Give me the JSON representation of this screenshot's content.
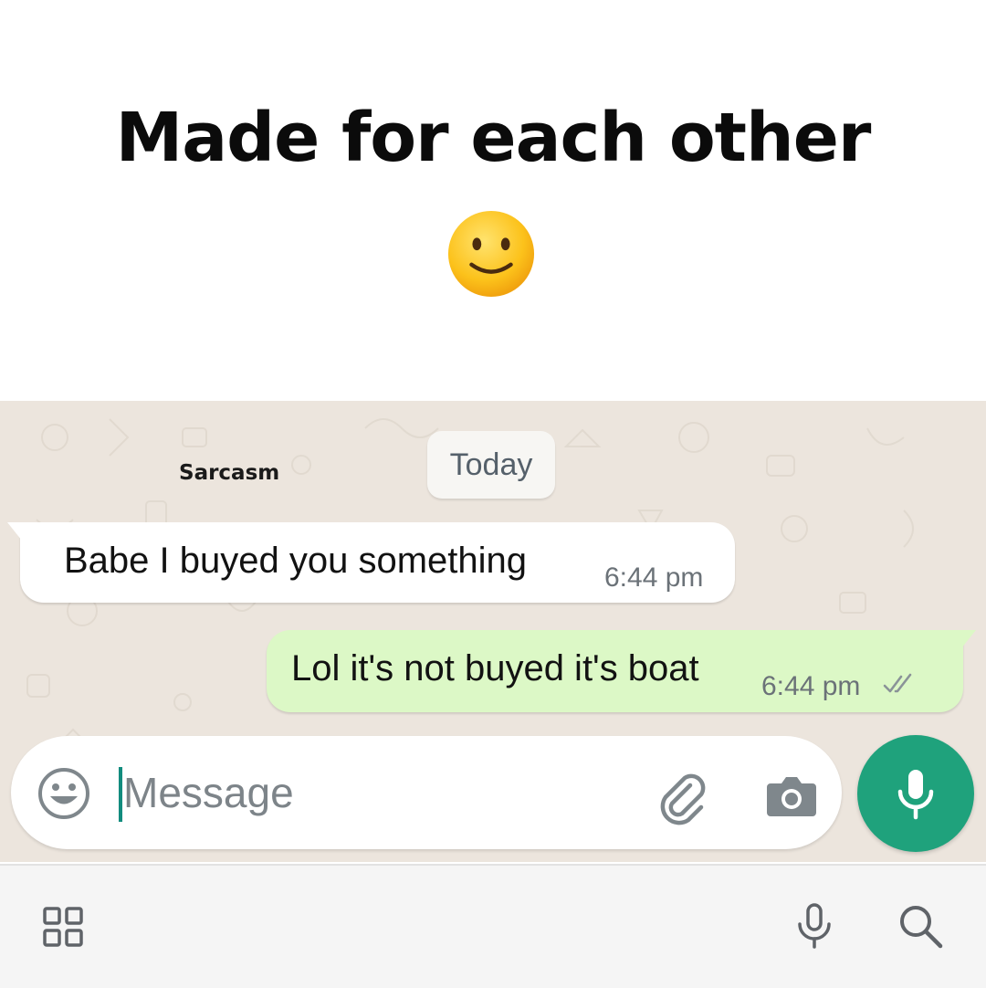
{
  "header": {
    "title": "Made for each other",
    "emoji": "slightly-smiling-face"
  },
  "chat": {
    "watermark": "Sarcasm",
    "date_chip": "Today",
    "messages": [
      {
        "direction": "incoming",
        "text": "Babe I buyed you something",
        "time": "6:44 pm"
      },
      {
        "direction": "outgoing",
        "text": "Lol it's not buyed it's boat",
        "time": "6:44 pm",
        "status": "double-check-icon"
      }
    ],
    "colors": {
      "wallpaper": "#ece5dd",
      "incoming_bubble": "#ffffff",
      "outgoing_bubble": "#dcf8c6",
      "accent": "#1fa27c"
    }
  },
  "composer": {
    "placeholder": "Message",
    "icons": [
      "emoji-face-icon",
      "paperclip-icon",
      "camera-icon",
      "microphone-icon"
    ]
  },
  "keyboard_bar": {
    "icons": [
      "apps-grid-icon",
      "microphone-icon",
      "search-icon"
    ]
  }
}
